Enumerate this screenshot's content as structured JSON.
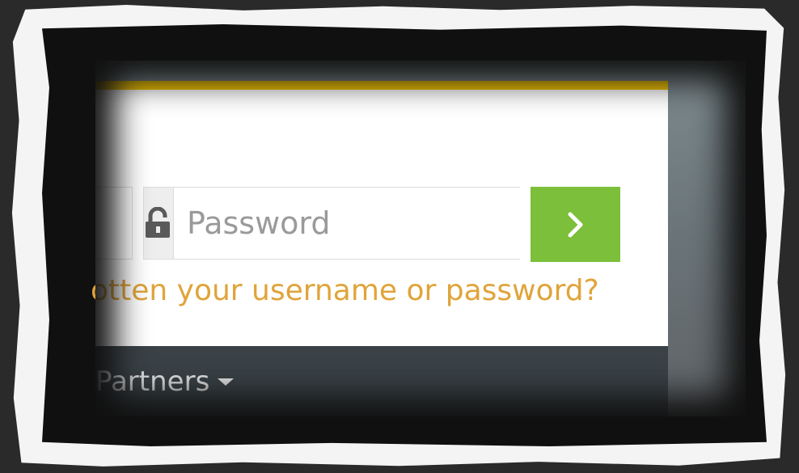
{
  "login": {
    "password_placeholder": "Password",
    "forgot_text": "otten your username or password?",
    "submit_icon": "chevron-right-icon",
    "lock_icon": "unlock-icon"
  },
  "nav": {
    "partners_label": "Partners"
  },
  "colors": {
    "top_accent": "#f4c400",
    "button": "#7cbf3b",
    "link": "#e0a43a",
    "navbar": "#3a4247"
  }
}
